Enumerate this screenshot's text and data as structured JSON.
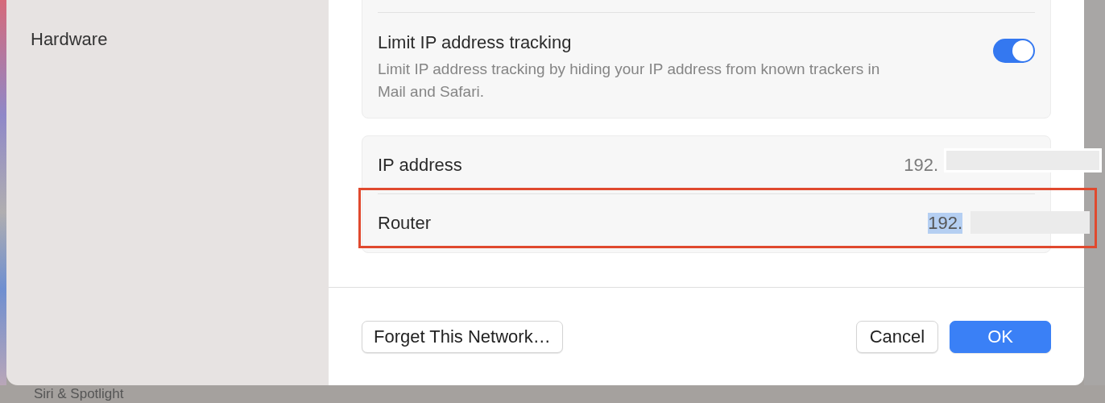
{
  "sidebar": {
    "items": [
      {
        "label": "Hardware"
      }
    ]
  },
  "privacy": {
    "title": "Limit IP address tracking",
    "description": "Limit IP address tracking by hiding your IP address from known trackers in Mail and Safari.",
    "on": true
  },
  "details": [
    {
      "label": "IP address",
      "value": "192.",
      "selected": false,
      "annotated": false
    },
    {
      "label": "Router",
      "value": "192.",
      "selected": true,
      "annotated": true
    }
  ],
  "buttons": [
    {
      "label": "Forget This Network…",
      "kind": "secondary"
    },
    {
      "label": "Cancel",
      "kind": "secondary"
    },
    {
      "label": "OK",
      "kind": "primary"
    }
  ],
  "background_item": {
    "label": "Siri & Spotlight"
  }
}
